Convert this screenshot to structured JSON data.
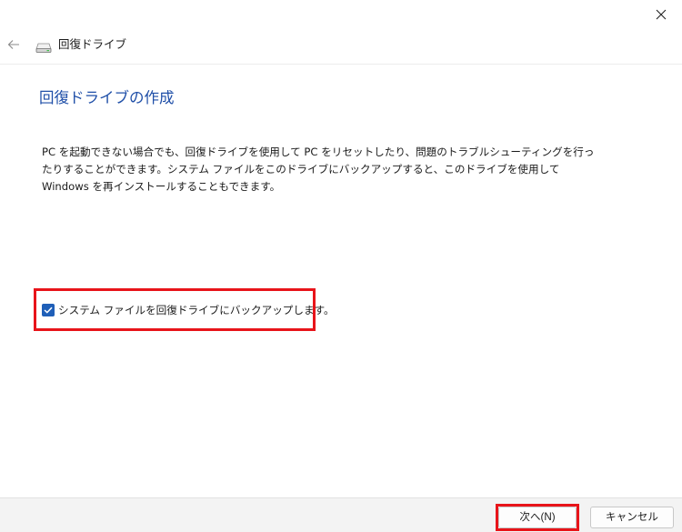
{
  "window": {
    "close_glyph": "close-icon"
  },
  "nav": {
    "title": "回復ドライブ",
    "back_icon": "arrow-left-icon",
    "drive_icon": "drive-icon"
  },
  "main": {
    "heading": "回復ドライブの作成",
    "description": "PC を起動できない場合でも、回復ドライブを使用して PC をリセットしたり、問題のトラブルシューティングを行ったりすることができます。システム ファイルをこのドライブにバックアップすると、このドライブを使用して Windows を再インストールすることもできます。",
    "backup_option": {
      "label": "システム ファイルを回復ドライブにバックアップします。",
      "checked": true
    }
  },
  "footer": {
    "next_label": "次へ(N)",
    "cancel_label": "キャンセル"
  },
  "colors": {
    "accent": "#1f5fb8",
    "heading": "#1f4fa8",
    "highlight": "#e8141a"
  }
}
